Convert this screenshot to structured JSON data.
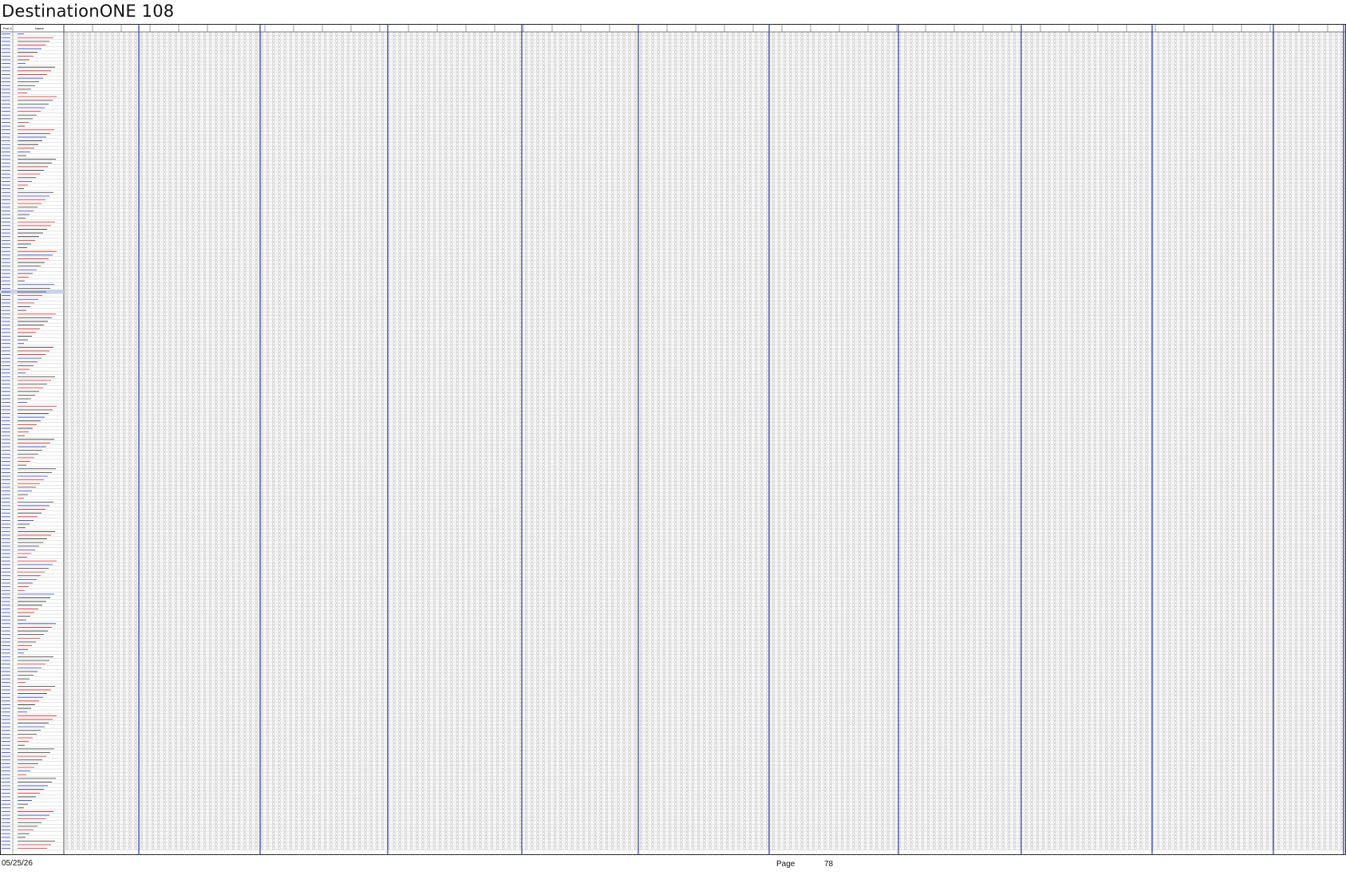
{
  "document": {
    "title": "DestinationONE 108"
  },
  "table": {
    "headers": [
      "Port #",
      "Name"
    ],
    "block_separator_color": "#2a3aa8",
    "row_band_color": "#c9d2ee",
    "cell_text_color_red": "#d22020",
    "cell_text_color_blue": "#2b3fbf",
    "marker_symbol": "circle"
  },
  "footer": {
    "date": "05/25/26",
    "page_label": "Page",
    "page_number": "78"
  }
}
